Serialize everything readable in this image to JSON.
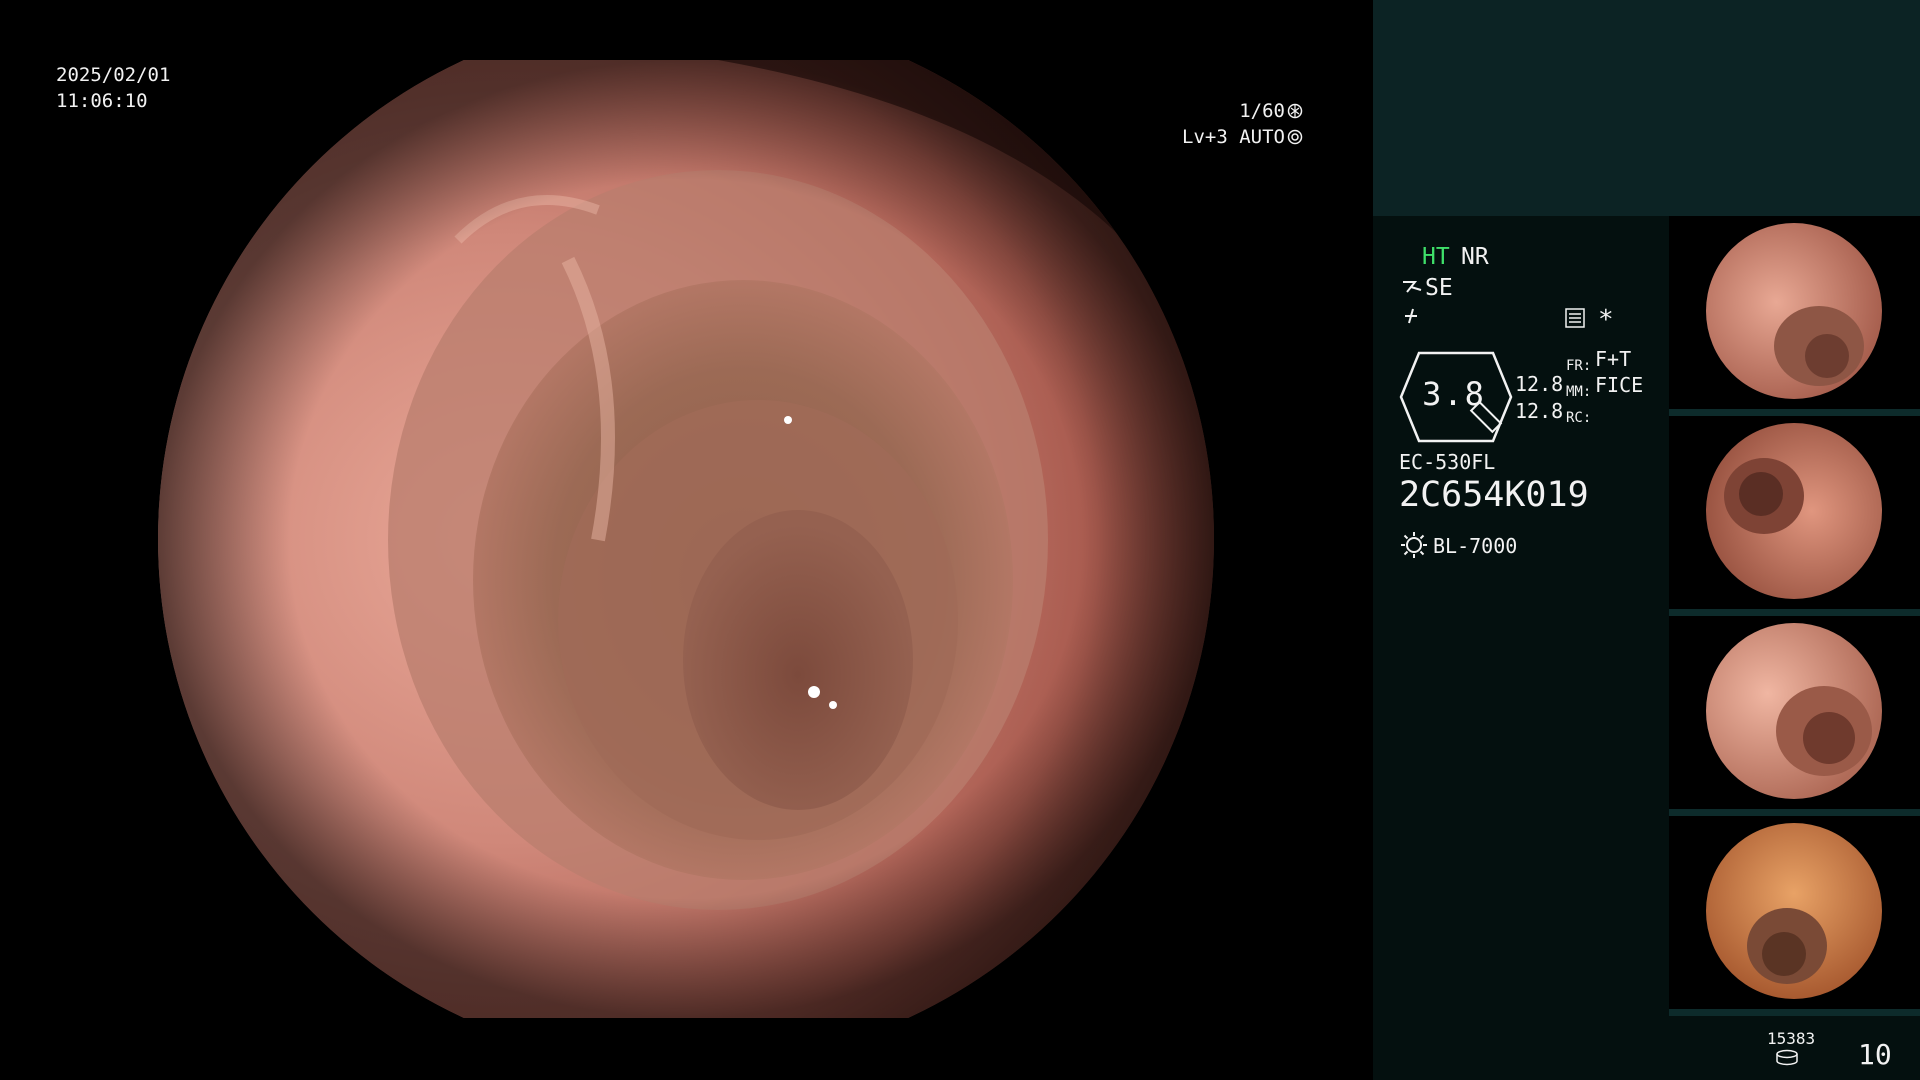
{
  "overlay": {
    "date": "2025/02/01",
    "time": "11:06:10",
    "shutter_speed": "1/60",
    "level": "Lv+3",
    "iris_mode": "AUTO"
  },
  "info": {
    "ht": "HT",
    "nr": "NR",
    "se": "SE",
    "zoom": "3.8",
    "value_1": "12.8",
    "value_2": "12.8",
    "fr_label": "FR:",
    "mm_label": "MM:",
    "rc_label": "RC:",
    "fr_value": "F+T",
    "mm_value": "FICE",
    "star": "*",
    "scope_model": "EC-530FL",
    "scope_serial": "2C654K019",
    "light_source": "BL-7000",
    "capture_count": "15383",
    "page_count": "10"
  },
  "colors": {
    "panel_top": "#0c2324",
    "panel": "#04100f",
    "accent_green": "#3fe06a"
  }
}
